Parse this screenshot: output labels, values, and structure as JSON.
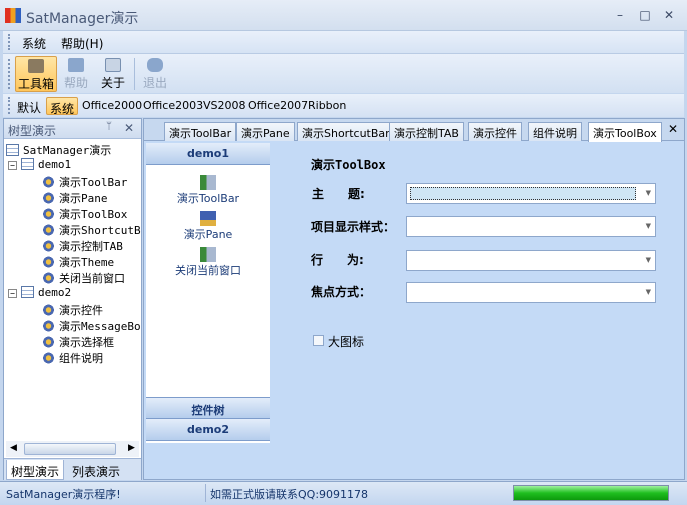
{
  "window": {
    "title": "SatManager演示",
    "minimize": "–",
    "maximize": "□",
    "close": "✕"
  },
  "menu": [
    "系统",
    "帮助(H)"
  ],
  "toolbar": [
    {
      "label": "工具箱",
      "icon": "toolbox-icon",
      "state": "active"
    },
    {
      "label": "帮助",
      "icon": "help-icon",
      "state": "disabled"
    },
    {
      "label": "关于",
      "icon": "about-icon",
      "state": "normal"
    },
    {
      "label": "退出",
      "icon": "exit-icon",
      "state": "disabled"
    }
  ],
  "themes": [
    "默认",
    "系统",
    "Office2000",
    "Office2003",
    "VS2008",
    "Office2007",
    "Ribbon"
  ],
  "selected_theme": "系统",
  "left_panel": {
    "title": "树型演示",
    "pin": "📌",
    "close": "✕",
    "tree": {
      "root": "SatManager演示",
      "groups": [
        {
          "label": "demo1",
          "items": [
            "演示ToolBar",
            "演示Pane",
            "演示ToolBox",
            "演示ShortcutBar",
            "演示控制TAB",
            "演示Theme",
            "关闭当前窗口"
          ]
        },
        {
          "label": "demo2",
          "items": [
            "演示控件",
            "演示MessageBox",
            "演示选择框",
            "组件说明"
          ]
        }
      ]
    },
    "tabs": [
      "树型演示",
      "列表演示"
    ]
  },
  "main": {
    "tabs": [
      "演示ToolBar",
      "演示Pane",
      "演示ShortcutBar",
      "演示控制TAB",
      "演示控件",
      "组件说明",
      "演示ToolBox"
    ],
    "active_tab": "演示ToolBox",
    "close": "✕",
    "navbar": {
      "top_group": "demo1",
      "items": [
        "演示ToolBar",
        "演示Pane",
        "关闭当前窗口"
      ],
      "bottom_groups": [
        "控件树",
        "demo2"
      ]
    },
    "form": {
      "title": "演示ToolBox",
      "fields": [
        {
          "label": "主　　题:",
          "value": ""
        },
        {
          "label": "项目显示样式：",
          "value": ""
        },
        {
          "label": "行　　为:",
          "value": ""
        },
        {
          "label": "焦点方式：",
          "value": ""
        }
      ],
      "checkbox": {
        "label": "大图标",
        "checked": false
      }
    }
  },
  "status": {
    "left": "SatManager演示程序!",
    "middle": "如需正式版请联系QQ:9091178",
    "progress": 1.0
  },
  "colors": {
    "accent": "#ffc65a",
    "panel": "#c4daf6",
    "progress": "#1fbf1f"
  }
}
